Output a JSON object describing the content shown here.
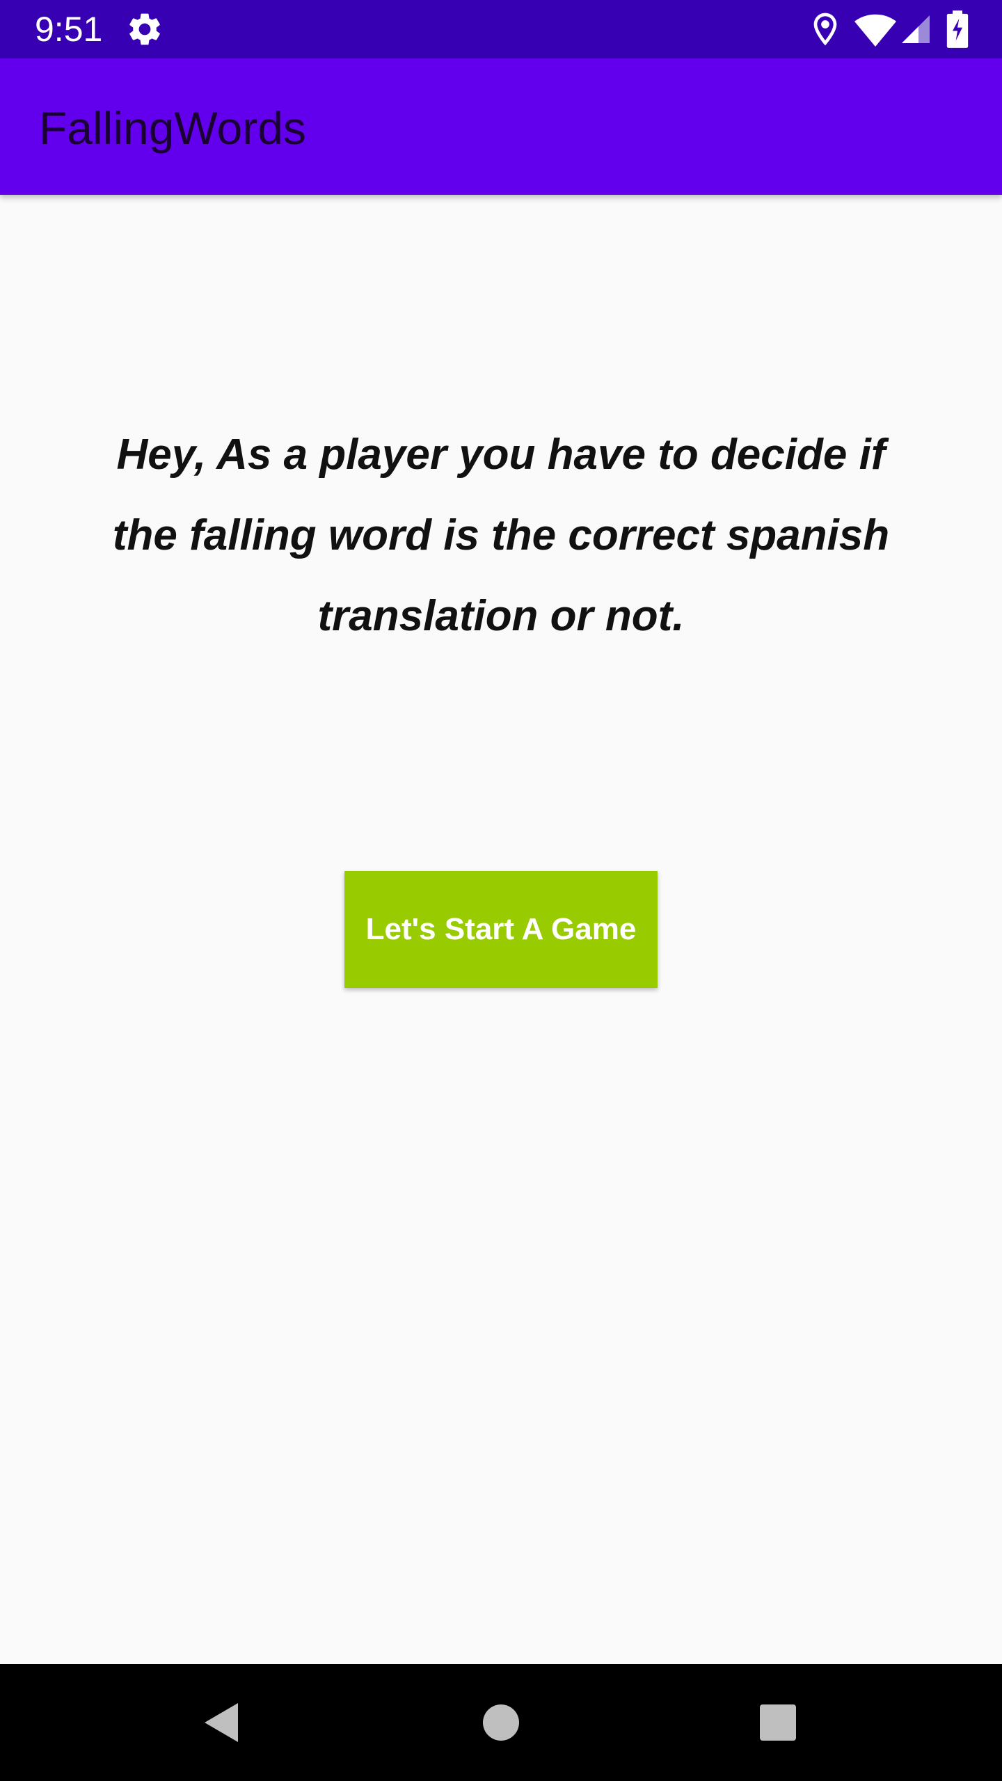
{
  "status_bar": {
    "time": "9:51",
    "background_color": "#3700b3",
    "icons": [
      "gear-icon",
      "location-icon",
      "wifi-icon",
      "signal-icon",
      "battery-icon"
    ]
  },
  "app_bar": {
    "title": "FallingWords",
    "background_color": "#6200ee"
  },
  "main": {
    "instructions": "Hey, As a player you have to decide if the falling word is the correct spanish translation or not.",
    "start_button_label": "Let's Start A Game",
    "start_button_color": "#99cc00"
  },
  "nav_bar": {
    "icons": [
      "back-icon",
      "home-icon",
      "recents-icon"
    ]
  }
}
